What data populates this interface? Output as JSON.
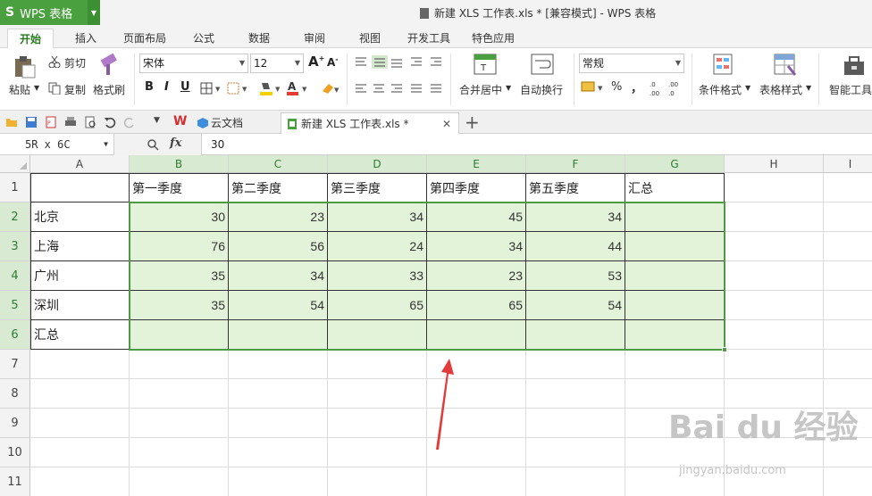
{
  "app": {
    "name": "WPS 表格",
    "doc_title": "新建 XLS 工作表.xls * [兼容模式] - WPS 表格"
  },
  "menu": {
    "tabs": [
      "开始",
      "插入",
      "页面布局",
      "公式",
      "数据",
      "审阅",
      "视图",
      "开发工具",
      "特色应用"
    ]
  },
  "ribbon": {
    "cut": "剪切",
    "copy": "复制",
    "paste": "粘贴",
    "format_painter": "格式刷",
    "font_name": "宋体",
    "font_size": "12",
    "merge_center": "合并居中",
    "wrap_text": "自动换行",
    "number_format": "常规",
    "cond_format": "条件格式",
    "table_style": "表格样式",
    "smart_tools": "智能工具",
    "bold": "B",
    "italic": "I",
    "underline": "U",
    "font_grow": "A",
    "font_shrink": "A",
    "percent": "%",
    "comma": "，"
  },
  "doc_tabs": {
    "cloud": "云文档",
    "current": "新建 XLS 工作表.xls *",
    "add": "+"
  },
  "formula": {
    "name_box": "5R x 6C",
    "fx_label": "fx",
    "value": "30"
  },
  "columns": [
    "A",
    "B",
    "C",
    "D",
    "E",
    "F",
    "G",
    "H",
    "I"
  ],
  "rows": [
    "1",
    "2",
    "3",
    "4",
    "5",
    "6",
    "7",
    "8",
    "9",
    "10",
    "11"
  ],
  "table": {
    "headers": [
      "第一季度",
      "第二季度",
      "第三季度",
      "第四季度",
      "第五季度",
      "汇总"
    ],
    "row_labels": [
      "北京",
      "上海",
      "广州",
      "深圳",
      "汇总"
    ],
    "values": [
      [
        30,
        23,
        34,
        45,
        34
      ],
      [
        76,
        56,
        24,
        34,
        44
      ],
      [
        35,
        34,
        33,
        23,
        53
      ],
      [
        35,
        54,
        65,
        65,
        54
      ]
    ]
  },
  "watermark": {
    "brand": "Bai du 经验",
    "url": "jingyan.baidu.com"
  },
  "colors": {
    "accent": "#4aa03f",
    "selection": "#4f9a44",
    "selection_fill": "#e2f3d9",
    "arrow": "#e33a3a"
  }
}
